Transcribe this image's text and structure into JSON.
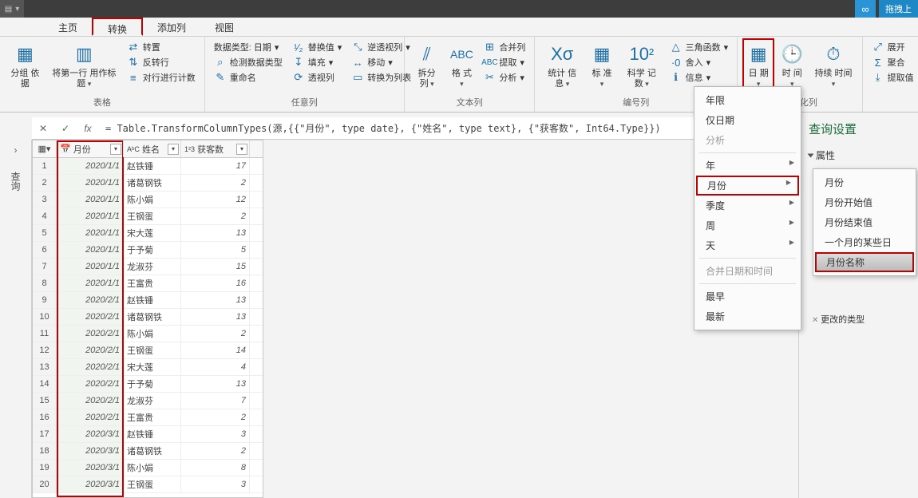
{
  "titlebar": {
    "drag_hint": "拖拽上"
  },
  "menu": {
    "home": "主页",
    "transform": "转换",
    "add_column": "添加列",
    "view": "视图"
  },
  "ribbon": {
    "groups": {
      "table": "表格",
      "any_col": "任意列",
      "text_col": "文本列",
      "number_col": "编号列",
      "datetime_col": "结构化列"
    },
    "group_by": "分组\n依据",
    "first_row_header": "将第一行\n用作标题",
    "transpose": "转置",
    "reverse_rows": "反转行",
    "count_rows": "对行进行计数",
    "data_type": "数据类型: 日期",
    "detect_type": "检测数据类型",
    "rename": "重命名",
    "replace": "替换值",
    "fill": "填充",
    "pivot": "透视列",
    "unpivot": "逆透视列",
    "move": "移动",
    "to_list": "转换为列表",
    "split": "拆分\n列",
    "format": "格\n式",
    "merge": "合并列",
    "extract": "提取",
    "analyze": "分析",
    "stats": "统计\n信息",
    "std": "标\n准",
    "sci": "科学\n记数",
    "trig": "三角函数",
    "rounding": "舍入",
    "info": "信息",
    "ten": "10",
    "date": "日\n期",
    "time": "时\n间",
    "duration": "持续\n时间",
    "expand": "展开",
    "aggregate": "聚合",
    "extract_val": "提取值"
  },
  "formula": "= Table.TransformColumnTypes(源,{{\"月份\", type date}, {\"姓名\", type text}, {\"获客数\", Int64.Type}})",
  "columns": {
    "date": "月份",
    "name": "姓名",
    "num": "获客数",
    "date_icon": "📅",
    "name_icon": "AᵇC",
    "num_icon": "1²3"
  },
  "rows": [
    {
      "d": "2020/1/1",
      "n": "赵铁锤",
      "v": 17
    },
    {
      "d": "2020/1/1",
      "n": "诸葛钢铁",
      "v": 2
    },
    {
      "d": "2020/1/1",
      "n": "陈小娟",
      "v": 12
    },
    {
      "d": "2020/1/1",
      "n": "王钢蛋",
      "v": 2
    },
    {
      "d": "2020/1/1",
      "n": "宋大莲",
      "v": 13
    },
    {
      "d": "2020/1/1",
      "n": "于予菊",
      "v": 5
    },
    {
      "d": "2020/1/1",
      "n": "龙淑芬",
      "v": 15
    },
    {
      "d": "2020/1/1",
      "n": "王富贵",
      "v": 16
    },
    {
      "d": "2020/2/1",
      "n": "赵铁锤",
      "v": 13
    },
    {
      "d": "2020/2/1",
      "n": "诸葛钢铁",
      "v": 13
    },
    {
      "d": "2020/2/1",
      "n": "陈小娟",
      "v": 2
    },
    {
      "d": "2020/2/1",
      "n": "王钢蛋",
      "v": 14
    },
    {
      "d": "2020/2/1",
      "n": "宋大莲",
      "v": 4
    },
    {
      "d": "2020/2/1",
      "n": "于予菊",
      "v": 13
    },
    {
      "d": "2020/2/1",
      "n": "龙淑芬",
      "v": 7
    },
    {
      "d": "2020/2/1",
      "n": "王富贵",
      "v": 2
    },
    {
      "d": "2020/3/1",
      "n": "赵铁锤",
      "v": 3
    },
    {
      "d": "2020/3/1",
      "n": "诸葛钢铁",
      "v": 2
    },
    {
      "d": "2020/3/1",
      "n": "陈小娟",
      "v": 8
    },
    {
      "d": "2020/3/1",
      "n": "王钢蛋",
      "v": 3
    }
  ],
  "queries_label": "查询",
  "settings": {
    "title": "查询设置",
    "properties": "属性",
    "applied_steps": "更改的类型"
  },
  "ctx1": {
    "age": "年限",
    "date_only": "仅日期",
    "analyze": "分析",
    "year": "年",
    "month": "月份",
    "quarter": "季度",
    "week": "周",
    "day": "天",
    "combine": "合并日期和时间",
    "earliest": "最早",
    "latest": "最新"
  },
  "ctx2": {
    "month": "月份",
    "month_start": "月份开始值",
    "month_end": "月份结束值",
    "days_in_month": "一个月的某些日",
    "month_name": "月份名称"
  },
  "num_label": "²"
}
